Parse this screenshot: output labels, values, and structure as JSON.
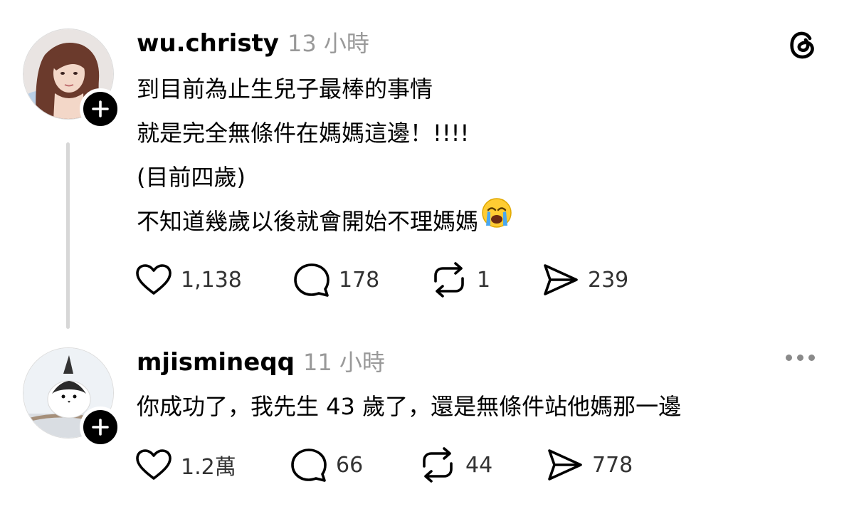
{
  "posts": [
    {
      "username": "wu.christy",
      "time": "13 小時",
      "lines": [
        "到目前為止生兒子最棒的事情",
        "就是完全無條件在媽媽這邊！!!!!",
        "(目前四歲)",
        "不知道幾歲以後就會開始不理媽媽"
      ],
      "emoji": "loudly-crying-face",
      "likes": "1,138",
      "replies": "178",
      "reposts": "1",
      "shares": "239"
    },
    {
      "username": "mjismineqq",
      "time": "11 小時",
      "lines": [
        "你成功了，我先生 43 歲了，還是無條件站他媽那一邊"
      ],
      "likes": "1.2萬",
      "replies": "66",
      "reposts": "44",
      "shares": "778"
    }
  ],
  "icons": {
    "logo": "threads-logo-icon",
    "more": "more-options-icon",
    "follow": "plus-icon",
    "like": "heart-icon",
    "reply": "comment-icon",
    "repost": "repost-icon",
    "share": "share-icon"
  },
  "colors": {
    "text": "#000000",
    "muted": "#999999",
    "count": "#333333",
    "thread_line": "#d7d7d7",
    "follow_bg": "#000000"
  }
}
